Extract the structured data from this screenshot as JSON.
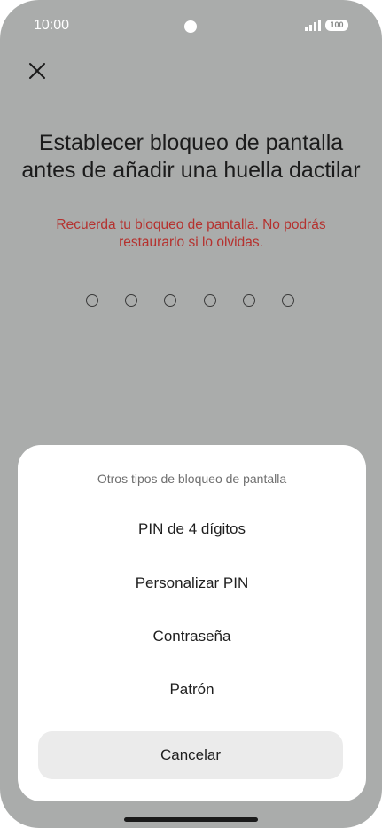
{
  "status_bar": {
    "time": "10:00",
    "battery": "100",
    "signal_icon": "signal-bars-icon",
    "battery_icon": "battery-icon"
  },
  "header": {
    "close_icon": "close-icon",
    "title": "Establecer bloqueo de pantalla antes de añadir una huella dactilar",
    "warning": "Recuerda tu bloqueo de pantalla. No podrás restaurarlo si lo olvidas."
  },
  "pin_entry": {
    "digits_total": 6,
    "digits_entered": 0
  },
  "sheet": {
    "title": "Otros tipos de bloqueo de pantalla",
    "options": [
      {
        "label": "PIN de 4 dígitos"
      },
      {
        "label": "Personalizar PIN"
      },
      {
        "label": "Contraseña"
      },
      {
        "label": "Patrón"
      }
    ],
    "cancel_label": "Cancelar"
  },
  "colors": {
    "background": "#aaacab",
    "warning": "#b5312e",
    "sheet": "#ffffff",
    "cancel_button": "#ebebeb"
  }
}
